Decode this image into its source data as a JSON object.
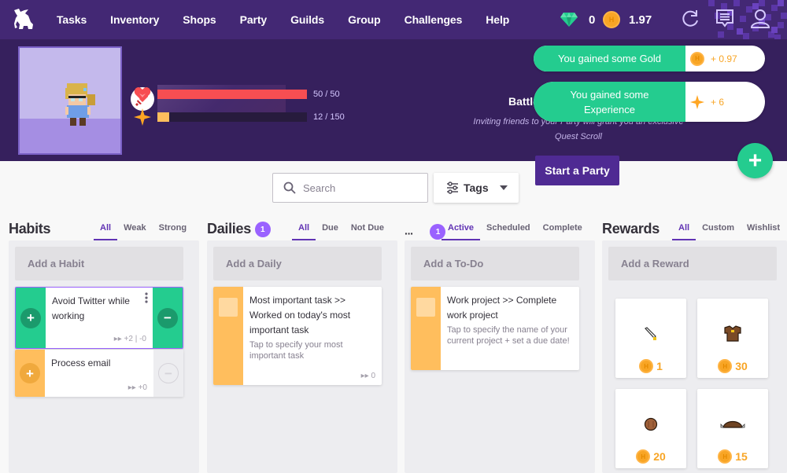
{
  "nav": {
    "items": [
      "Tasks",
      "Inventory",
      "Shops",
      "Party",
      "Guilds",
      "Group",
      "Challenges",
      "Help"
    ],
    "gems": "0",
    "gold": "1.97",
    "icons": [
      "gem-icon",
      "gold-coin-icon",
      "sync-icon",
      "notifications-icon",
      "user-icon"
    ],
    "colors": {
      "nav_bg": "#432874",
      "header_bg": "#36205d"
    }
  },
  "header": {
    "class_icon": "warrior-sword-icon",
    "health": {
      "current": 50,
      "max": 50,
      "text": "50 / 50",
      "color": "#f74e52"
    },
    "experience": {
      "current": 12,
      "max": 150,
      "text": "12 / 150",
      "color": "#ffbe5d"
    },
    "party_title": "Battle",
    "party_desc_line1": "Inviting friends to your Party will grant you an exclusive",
    "party_desc_line2": "Quest Scroll",
    "start_party": "Start a Party"
  },
  "notifications": [
    {
      "message": "You gained some Gold",
      "amount": "+ 0.97",
      "icon": "gold-coin-icon"
    },
    {
      "message": "You gained some Experience",
      "amount": "+ 6",
      "icon": "experience-star-icon"
    }
  ],
  "toolbar": {
    "search_placeholder": "Search",
    "tags_label": "Tags"
  },
  "columns": {
    "habits": {
      "title": "Habits",
      "filters": [
        "All",
        "Weak",
        "Strong"
      ],
      "active_filter": "All",
      "add_label": "Add a Habit",
      "tasks": [
        {
          "title": "Avoid Twitter while working",
          "meta": "+2 | -0",
          "color": "#24cc8f"
        },
        {
          "title": "Process email",
          "meta": "+0",
          "color": "#ffbe5d"
        }
      ]
    },
    "dailies": {
      "title": "Dailies",
      "badge": "1",
      "filters": [
        "All",
        "Due",
        "Not Due"
      ],
      "active_filter": "All",
      "add_label": "Add a Daily",
      "tasks": [
        {
          "title": "Most important task >> Worked on today's most important task",
          "notes": "Tap to specify your most important task",
          "meta": "0"
        }
      ]
    },
    "todos": {
      "title": "...",
      "badge": "1",
      "filters": [
        "Active",
        "Scheduled",
        "Complete"
      ],
      "active_filter": "Active",
      "add_label": "Add a To-Do",
      "tasks": [
        {
          "title": "Work project >> Complete work project",
          "notes": "Tap to specify the name of your current project + set a due date!"
        }
      ]
    },
    "rewards": {
      "title": "Rewards",
      "filters": [
        "All",
        "Custom",
        "Wishlist"
      ],
      "active_filter": "All",
      "add_label": "Add a Reward",
      "items": [
        {
          "icon": "training-sword-icon",
          "price": "1"
        },
        {
          "icon": "leather-armor-icon",
          "price": "30"
        },
        {
          "icon": "wooden-shield-icon",
          "price": "20"
        },
        {
          "icon": "leather-helm-icon",
          "price": "15"
        }
      ]
    }
  }
}
